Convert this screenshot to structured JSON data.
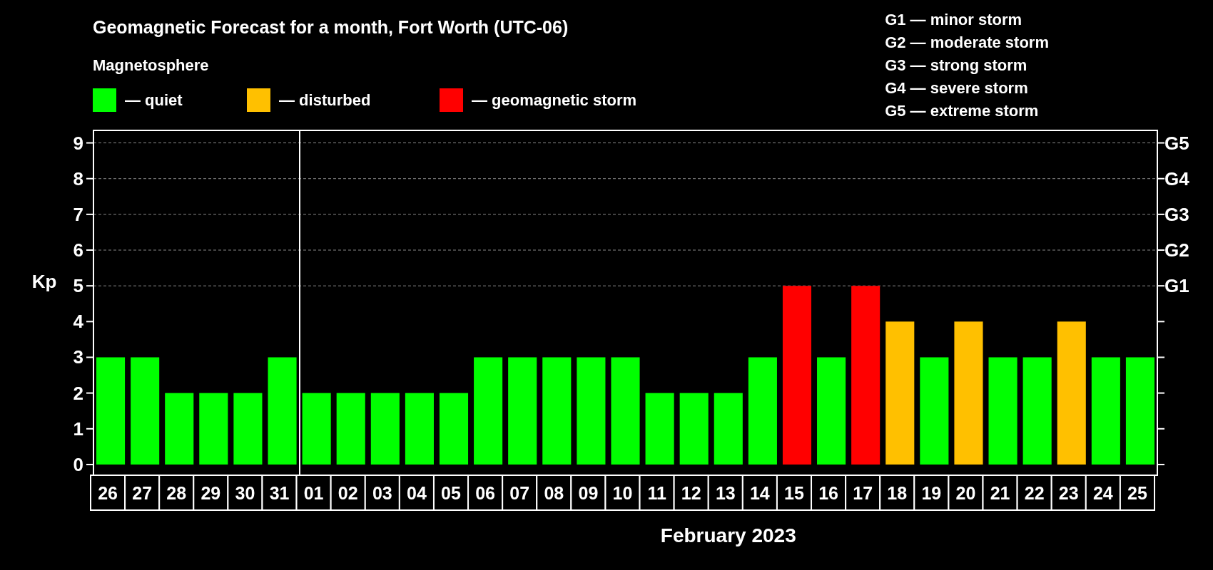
{
  "title": "Geomagnetic Forecast for a month, Fort Worth (UTC-06)",
  "legend": {
    "title": "Magnetosphere",
    "separator": "—"
  },
  "storm_scale": [
    "G1 — minor storm",
    "G2 — moderate storm",
    "G3 — strong storm",
    "G4 — severe storm",
    "G5 — extreme storm"
  ],
  "chart_data": {
    "type": "bar",
    "ylabel": "Kp",
    "xlabel": "February 2023",
    "categories": [
      "26",
      "27",
      "28",
      "29",
      "30",
      "31",
      "01",
      "02",
      "03",
      "04",
      "05",
      "06",
      "07",
      "08",
      "09",
      "10",
      "11",
      "12",
      "13",
      "14",
      "15",
      "16",
      "17",
      "18",
      "19",
      "20",
      "21",
      "22",
      "23",
      "24",
      "25"
    ],
    "series": [
      {
        "name": "quiet",
        "color": "#00ff00",
        "values": [
          3,
          3,
          2,
          2,
          2,
          3,
          2,
          2,
          2,
          2,
          2,
          3,
          3,
          3,
          3,
          3,
          2,
          2,
          2,
          3,
          null,
          3,
          null,
          null,
          3,
          null,
          3,
          3,
          null,
          3,
          3
        ]
      },
      {
        "name": "disturbed",
        "color": "#ffc000",
        "values": [
          null,
          null,
          null,
          null,
          null,
          null,
          null,
          null,
          null,
          null,
          null,
          null,
          null,
          null,
          null,
          null,
          null,
          null,
          null,
          null,
          null,
          null,
          null,
          4,
          null,
          4,
          null,
          null,
          4,
          null,
          null
        ]
      },
      {
        "name": "geomagnetic storm",
        "color": "#ff0000",
        "values": [
          null,
          null,
          null,
          null,
          null,
          null,
          null,
          null,
          null,
          null,
          null,
          null,
          null,
          null,
          null,
          null,
          null,
          null,
          null,
          null,
          5,
          null,
          5,
          null,
          null,
          null,
          null,
          null,
          null,
          null,
          null
        ]
      }
    ],
    "ylim": [
      -0.3,
      9.35
    ],
    "yticks": [
      0,
      1,
      2,
      3,
      4,
      5,
      6,
      7,
      8,
      9
    ],
    "grid": true,
    "y2ticks": [
      null,
      null,
      null,
      null,
      null,
      "G1",
      "G2",
      "G3",
      "G4",
      "G5"
    ]
  }
}
